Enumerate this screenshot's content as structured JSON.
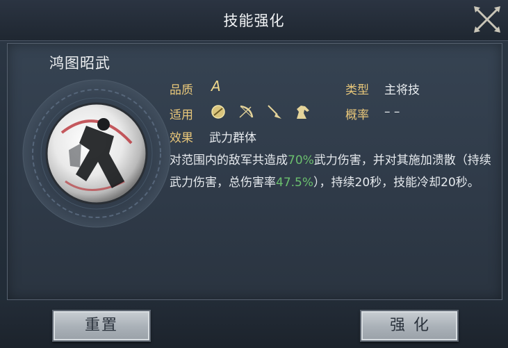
{
  "window": {
    "title": "技能强化"
  },
  "skill": {
    "name": "鸿图昭武",
    "quality_label": "品质",
    "quality_value": "A",
    "type_label": "类型",
    "type_value": "主将技",
    "applies_label": "适用",
    "applies_icons": [
      "shield-icon",
      "bow-icon",
      "spear-icon",
      "horse-icon"
    ],
    "chance_label": "概率",
    "chance_value": "– –",
    "effect_label": "效果",
    "effect_value": "武力群体",
    "description": {
      "p1": "对范围内的敌军共造成",
      "v1": "70%",
      "p2": "武力伤害，并对其施加溃散（持续武力伤害，总伤害率",
      "v2": "47.5%",
      "p3": "），持续20秒，技能冷却20秒。"
    }
  },
  "buttons": {
    "reset": "重置",
    "enhance": "强化"
  },
  "colors": {
    "label": "#e8c77a",
    "highlight": "#6bbf6e",
    "button": "#b4bac0"
  }
}
